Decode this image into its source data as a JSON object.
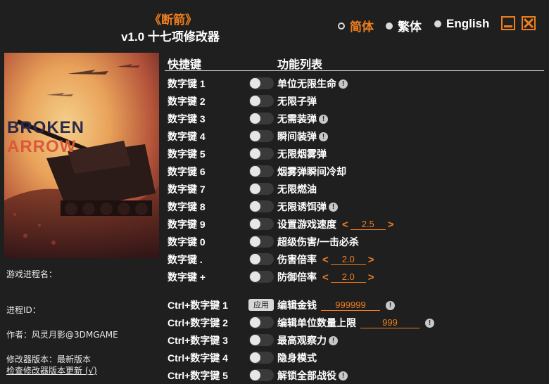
{
  "app": {
    "game_title": "《断箭》",
    "version_title": "v1.0 十七项修改器"
  },
  "languages": [
    {
      "label": "简体",
      "selected": true
    },
    {
      "label": "繁体",
      "selected": false
    },
    {
      "label": "English",
      "selected": false
    }
  ],
  "window_controls": {
    "minimize_icon": "minimize-icon",
    "close_icon": "close-icon"
  },
  "cover": {
    "line1": "BROKEN",
    "line2": "ARROW"
  },
  "info": {
    "process_name_label": "游戏进程名：",
    "process_id_label": "进程ID：",
    "author": "作者：风灵月影@3DMGAME",
    "trainer_version": "修改器版本：最新版本",
    "check_update": "检查修改器版本更新 (√)"
  },
  "table": {
    "header_key": "快捷键",
    "header_feature": "功能列表",
    "apply_label": "应用",
    "rows": [
      {
        "key": "数字键 1",
        "feature": "单位无限生命",
        "info": "!"
      },
      {
        "key": "数字键 2",
        "feature": "无限子弹"
      },
      {
        "key": "数字键 3",
        "feature": "无需装弹",
        "info": "!"
      },
      {
        "key": "数字键 4",
        "feature": "瞬间装弹",
        "info": "!"
      },
      {
        "key": "数字键 5",
        "feature": "无限烟雾弹"
      },
      {
        "key": "数字键 6",
        "feature": "烟雾弹瞬间冷却"
      },
      {
        "key": "数字键 7",
        "feature": "无限燃油"
      },
      {
        "key": "数字键 8",
        "feature": "无限诱饵弹",
        "info": "!"
      },
      {
        "key": "数字键 9",
        "feature": "设置游戏速度",
        "value": "2.5",
        "left": "<",
        "right": ">"
      },
      {
        "key": "数字键 0",
        "feature": "超级伤害/一击必杀"
      },
      {
        "key": "数字键 .",
        "feature": "伤害倍率",
        "value": "2.0",
        "left": "<",
        "right": ">"
      },
      {
        "key": "数字键 +",
        "feature": "防御倍率",
        "value": "2.0",
        "left": "<",
        "right": ">"
      },
      {
        "key": "Ctrl+数字键 1",
        "feature": "编辑金钱",
        "edit": "999999",
        "info": "!",
        "apply": true
      },
      {
        "key": "Ctrl+数字键 2",
        "feature": "编辑单位数量上限",
        "edit": "999",
        "info": "!"
      },
      {
        "key": "Ctrl+数字键 3",
        "feature": "最高观察力",
        "info": "!"
      },
      {
        "key": "Ctrl+数字键 4",
        "feature": "隐身模式"
      },
      {
        "key": "Ctrl+数字键 5",
        "feature": "解锁全部战役",
        "info": "!"
      }
    ]
  },
  "colors": {
    "accent": "#f07e1e",
    "background": "#1f1f1f"
  }
}
